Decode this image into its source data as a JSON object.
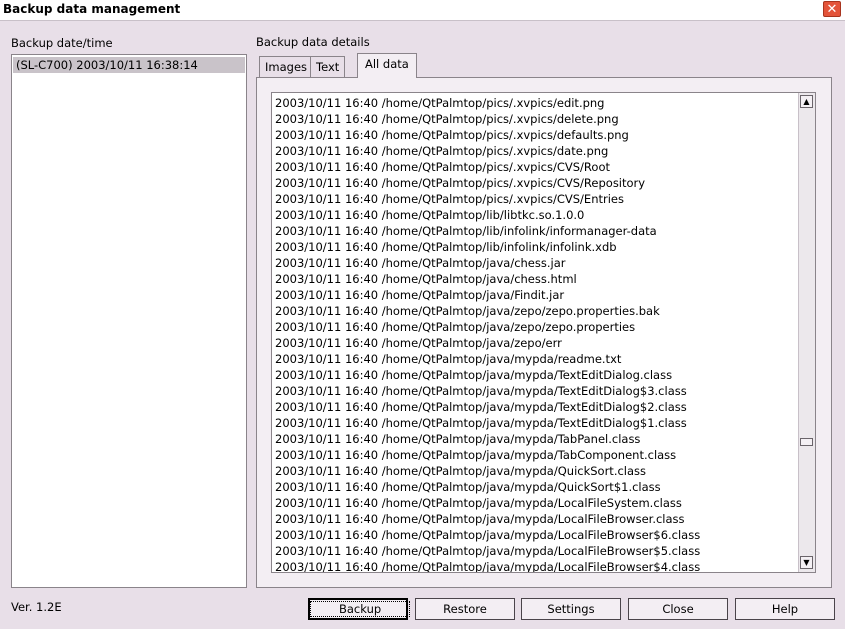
{
  "window": {
    "title": "Backup data management",
    "close_glyph": "✕"
  },
  "left_panel": {
    "label": "Backup date/time",
    "items": [
      {
        "label": "(SL-C700) 2003/10/11 16:38:14"
      }
    ]
  },
  "right_panel": {
    "label": "Backup data details",
    "tabs": [
      {
        "label": "Images"
      },
      {
        "label": "Text"
      },
      {
        "label": "All data"
      }
    ],
    "active_tab": "All data",
    "files": [
      "2003/10/11 16:40 /home/QtPalmtop/pics/.xvpics/edit.png",
      "2003/10/11 16:40 /home/QtPalmtop/pics/.xvpics/delete.png",
      "2003/10/11 16:40 /home/QtPalmtop/pics/.xvpics/defaults.png",
      "2003/10/11 16:40 /home/QtPalmtop/pics/.xvpics/date.png",
      "2003/10/11 16:40 /home/QtPalmtop/pics/.xvpics/CVS/Root",
      "2003/10/11 16:40 /home/QtPalmtop/pics/.xvpics/CVS/Repository",
      "2003/10/11 16:40 /home/QtPalmtop/pics/.xvpics/CVS/Entries",
      "2003/10/11 16:40 /home/QtPalmtop/lib/libtkc.so.1.0.0",
      "2003/10/11 16:40 /home/QtPalmtop/lib/infolink/informanager-data",
      "2003/10/11 16:40 /home/QtPalmtop/lib/infolink/infolink.xdb",
      "2003/10/11 16:40 /home/QtPalmtop/java/chess.jar",
      "2003/10/11 16:40 /home/QtPalmtop/java/chess.html",
      "2003/10/11 16:40 /home/QtPalmtop/java/Findit.jar",
      "2003/10/11 16:40 /home/QtPalmtop/java/zepo/zepo.properties.bak",
      "2003/10/11 16:40 /home/QtPalmtop/java/zepo/zepo.properties",
      "2003/10/11 16:40 /home/QtPalmtop/java/zepo/err",
      "2003/10/11 16:40 /home/QtPalmtop/java/mypda/readme.txt",
      "2003/10/11 16:40 /home/QtPalmtop/java/mypda/TextEditDialog.class",
      "2003/10/11 16:40 /home/QtPalmtop/java/mypda/TextEditDialog$3.class",
      "2003/10/11 16:40 /home/QtPalmtop/java/mypda/TextEditDialog$2.class",
      "2003/10/11 16:40 /home/QtPalmtop/java/mypda/TextEditDialog$1.class",
      "2003/10/11 16:40 /home/QtPalmtop/java/mypda/TabPanel.class",
      "2003/10/11 16:40 /home/QtPalmtop/java/mypda/TabComponent.class",
      "2003/10/11 16:40 /home/QtPalmtop/java/mypda/QuickSort.class",
      "2003/10/11 16:40 /home/QtPalmtop/java/mypda/QuickSort$1.class",
      "2003/10/11 16:40 /home/QtPalmtop/java/mypda/LocalFileSystem.class",
      "2003/10/11 16:40 /home/QtPalmtop/java/mypda/LocalFileBrowser.class",
      "2003/10/11 16:40 /home/QtPalmtop/java/mypda/LocalFileBrowser$6.class",
      "2003/10/11 16:40 /home/QtPalmtop/java/mypda/LocalFileBrowser$5.class",
      "2003/10/11 16:40 /home/QtPalmtop/java/mypda/LocalFileBrowser$4.class"
    ],
    "scroll_up_glyph": "▲",
    "scroll_down_glyph": "▼"
  },
  "footer": {
    "version": "Ver. 1.2E",
    "buttons": {
      "backup": "Backup",
      "restore": "Restore",
      "settings": "Settings",
      "close": "Close",
      "help": "Help"
    }
  }
}
